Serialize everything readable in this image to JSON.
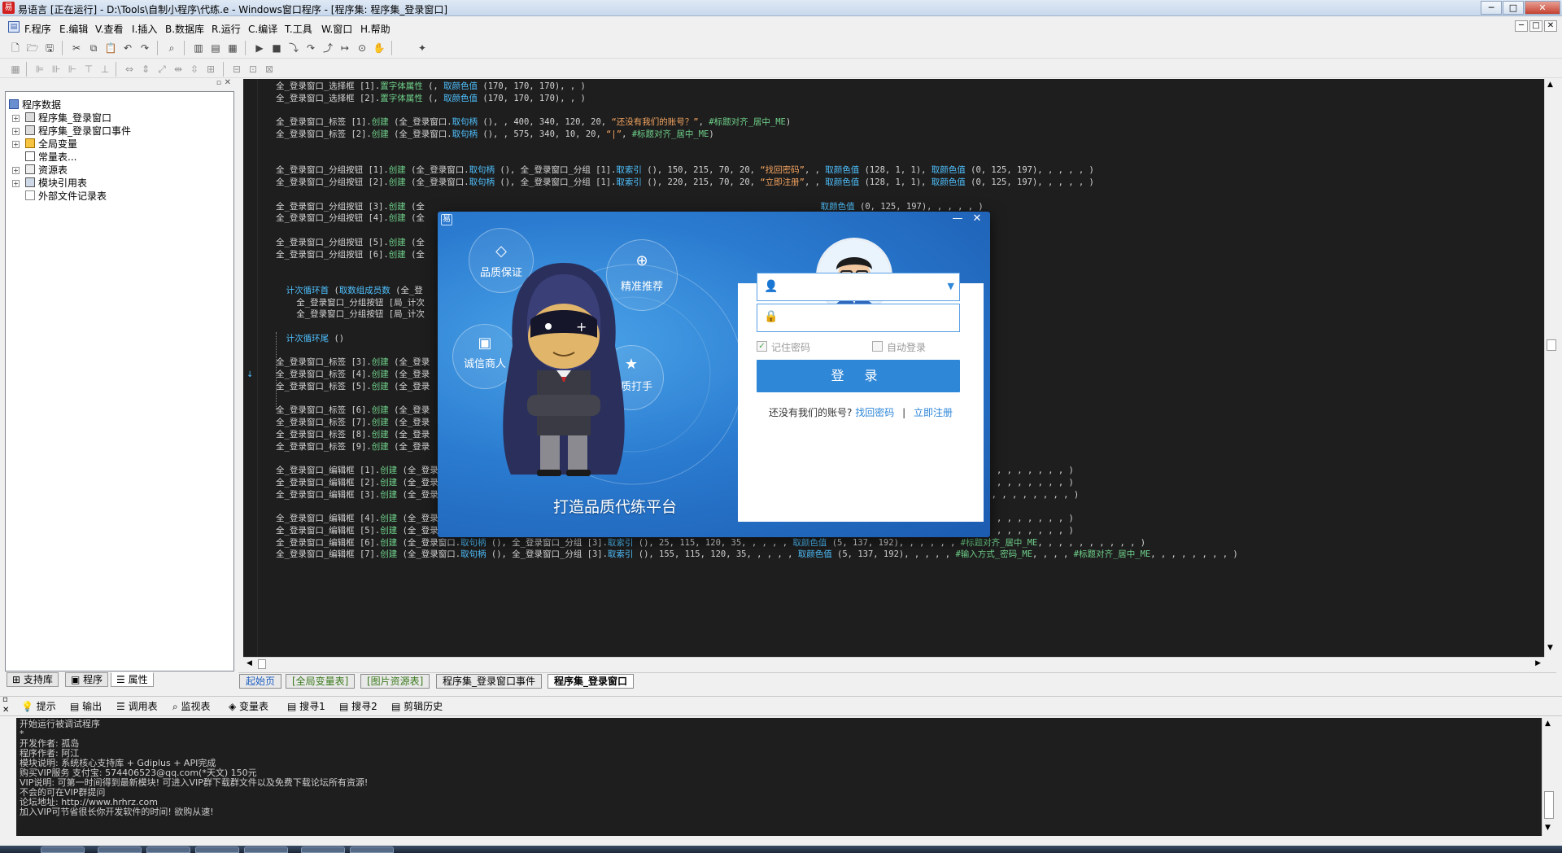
{
  "window": {
    "title": "易语言 [正在运行] - D:\\Tools\\自制小程序\\代练.e - Windows窗口程序 - [程序集: 程序集_登录窗口]",
    "app_icon_text": "易",
    "min": "─",
    "max": "□",
    "close": "✕"
  },
  "menu": [
    {
      "key": "F",
      "label": "F.程序"
    },
    {
      "key": "E",
      "label": "E.编辑"
    },
    {
      "key": "V",
      "label": "V.查看"
    },
    {
      "key": "I",
      "label": "I.插入"
    },
    {
      "key": "B",
      "label": "B.数据库"
    },
    {
      "key": "R",
      "label": "R.运行"
    },
    {
      "key": "C",
      "label": "C.编译"
    },
    {
      "key": "T",
      "label": "T.工具"
    },
    {
      "key": "W",
      "label": "W.窗口"
    },
    {
      "key": "H",
      "label": "H.帮助"
    }
  ],
  "tree": {
    "root": "程序数据",
    "items": [
      {
        "label": "程序集_登录窗口",
        "icon": "module-icon"
      },
      {
        "label": "程序集_登录窗口事件",
        "icon": "module-icon"
      },
      {
        "label": "全局变量",
        "icon": "variable-icon"
      },
      {
        "label": "常量表...",
        "icon": "constant-icon"
      },
      {
        "label": "资源表",
        "icon": "resource-icon"
      },
      {
        "label": "模块引用表",
        "icon": "module-ref-icon"
      },
      {
        "label": "外部文件记录表",
        "icon": "file-icon"
      }
    ]
  },
  "left_tabs": [
    "支持库",
    "程序",
    "属性"
  ],
  "code_lines": [
    {
      "t": "全_登录窗口_选择框 [1].置字体属性 (, 取颜色值 (170, 170, 170), , )"
    },
    {
      "t": "全_登录窗口_选择框 [2].置字体属性 (, 取颜色值 (170, 170, 170), , )"
    },
    {
      "t": ""
    },
    {
      "t": "全_登录窗口_标签 [1].创建 (全_登录窗口.取句柄 (), , 400, 340, 120, 20, “还没有我们的账号？”, #标题对齐_居中_ME)"
    },
    {
      "t": "全_登录窗口_标签 [2].创建 (全_登录窗口.取句柄 (), , 575, 340, 10, 20, “|”, #标题对齐_居中_ME)"
    },
    {
      "t": ""
    },
    {
      "t": ""
    },
    {
      "t": "全_登录窗口_分组按钮 [1].创建 (全_登录窗口.取句柄 (), 全_登录窗口_分组 [1].取索引 (), 150, 215, 70, 20, “找回密码”, , 取颜色值 (128, 1, 1), 取颜色值 (0, 125, 197), , , , , )"
    },
    {
      "t": "全_登录窗口_分组按钮 [2].创建 (全_登录窗口.取句柄 (), 全_登录窗口_分组 [1].取索引 (), 220, 215, 70, 20, “立即注册”, , 取颜色值 (128, 1, 1), 取颜色值 (0, 125, 197), , , , , )"
    },
    {
      "t": ""
    },
    {
      "t": "全_登录窗口_分组按钮 [3].创建 (全                                                                             取颜色值 (0, 125, 197), , , , , )"
    },
    {
      "t": "全_登录窗口_分组按钮 [4].创建 (全                                                                             取颜色值 (0, 125, 197), , , , , )"
    },
    {
      "t": ""
    },
    {
      "t": "全_登录窗口_分组按钮 [5].创建 (全                                                                             取颜色值 (0, 125, 197), , , , , )"
    },
    {
      "t": "全_登录窗口_分组按钮 [6].创建 (全                                                                             取颜色值 (0, 125, 197), , , , , )"
    },
    {
      "t": ""
    },
    {
      "t": ""
    },
    {
      "t": "  计次循环首 (取数组成员数 (全_登"
    },
    {
      "t": "    全_登录窗口_分组按钮 [局_计次"
    },
    {
      "t": "    全_登录窗口_分组按钮 [局_计次"
    },
    {
      "t": ""
    },
    {
      "t": "  计次循环尾 ()"
    },
    {
      "t": ""
    },
    {
      "t": "全_登录窗口_标签 [3].创建 (全_登录"
    },
    {
      "t": "全_登录窗口_标签 [4].创建 (全_登录"
    },
    {
      "t": "全_登录窗口_标签 [5].创建 (全_登录"
    },
    {
      "t": ""
    },
    {
      "t": "全_登录窗口_标签 [6].创建 (全_登录"
    },
    {
      "t": "全_登录窗口_标签 [7].创建 (全_登录"
    },
    {
      "t": "全_登录窗口_标签 [8].创建 (全_登录"
    },
    {
      "t": "全_登录窗口_标签 [9].创建 (全_登录"
    },
    {
      "t": ""
    },
    {
      "t": "全_登录窗口_编辑框 [1].创建 (全_登录窗口.取句柄 (), 全_登录窗口_分组 [2].取索引 (), 25, 25, 250, 35, , , , , 取颜色值 (5, 137, 192), , , , , , , , , , , , , , , , , )"
    },
    {
      "t": "全_登录窗口_编辑框 [2].创建 (全_登录窗口.取句柄 (), 全_登录窗口_分组 [2].取索引 (), 25, 70, 250, 35, , , , , 取颜色值 (5, 137, 192), , , , , , , , , , , , , , , , , )"
    },
    {
      "t": "全_登录窗口_编辑框 [3].创建 (全_登录窗口.取句柄 (), 全_登录窗口_分组 [2].取索引 (), 25, 115, 250, 35, , , , , 取颜色值 (5, 137, 192), , , , , , , , , , , , , , , , , )"
    },
    {
      "t": ""
    },
    {
      "t": "全_登录窗口_编辑框 [4].创建 (全_登录窗口.取句柄 (), 全_登录窗口_分组 [3].取索引 (), 25, 25, 250, 35, , , , , 取颜色值 (5, 137, 192), , , , , , , , , , , , , , , , , )"
    },
    {
      "t": "全_登录窗口_编辑框 [5].创建 (全_登录窗口.取句柄 (), 全_登录窗口_分组 [3].取索引 (), 25, 70, 250, 35, , , , , 取颜色值 (5, 137, 192), , , , , , , , , , , , , , , , , )"
    },
    {
      "t": "全_登录窗口_编辑框 [6].创建 (全_登录窗口.取句柄 (), 全_登录窗口_分组 [3].取索引 (), 25, 115, 120, 35, , , , , 取颜色值 (5, 137, 192), , , , , , #标题对齐_居中_ME, , , , , , , , , , )"
    },
    {
      "t": "全_登录窗口_编辑框 [7].创建 (全_登录窗口.取句柄 (), 全_登录窗口_分组 [3].取索引 (), 155, 115, 120, 35, , , , , 取颜色值 (5, 137, 192), , , , , #输入方式_密码_ME, , , , #标题对齐_居中_ME, , , , , , , , )"
    }
  ],
  "doc_tabs": [
    "起始页",
    "[全局变量表]",
    "[图片资源表]",
    "程序集_登录窗口事件",
    "程序集_登录窗口"
  ],
  "output_tabs": [
    "提示",
    "输出",
    "调用表",
    "监视表",
    "变量表",
    "搜寻1",
    "搜寻2",
    "剪辑历史"
  ],
  "output_lines": [
    "开始运行被调试程序",
    "*",
    "开发作者: 孤岛",
    "程序作者: 阿江",
    "模块说明: 系统核心支持库 + Gdiplus + API完成",
    "购买VIP服务 支付宝: 574406523@qq.com(*天文) 150元",
    "VIP说明: 可第一时间得到最新模块! 可进入VIP群下载群文件以及免费下载论坛所有资源!",
    "不会的可在VIP群提问",
    "论坛地址: http://www.hrhrz.com",
    "加入VIP可节省很长你开发软件的时间! 欲购从速!"
  ],
  "dialog": {
    "logo": "易",
    "min": "—",
    "close": "✕",
    "features": [
      {
        "label": "品质保证",
        "icon": "diamond-icon",
        "glyph": "◇"
      },
      {
        "label": "精准推荐",
        "icon": "target-icon",
        "glyph": "⊕"
      },
      {
        "label": "诚信商人",
        "icon": "shop-icon",
        "glyph": "▣"
      },
      {
        "label": "优质打手",
        "icon": "star-badge-icon",
        "glyph": "★"
      }
    ],
    "slogan": "打造品质代练平台",
    "username_value": "",
    "password_value": "",
    "remember_label": "记住密码",
    "remember_checked": true,
    "autologin_label": "自动登录",
    "autologin_checked": false,
    "login_label": "登 录",
    "no_account": "还没有我们的账号?",
    "find_password": "找回密码",
    "separator": "|",
    "register": "立即注册"
  }
}
